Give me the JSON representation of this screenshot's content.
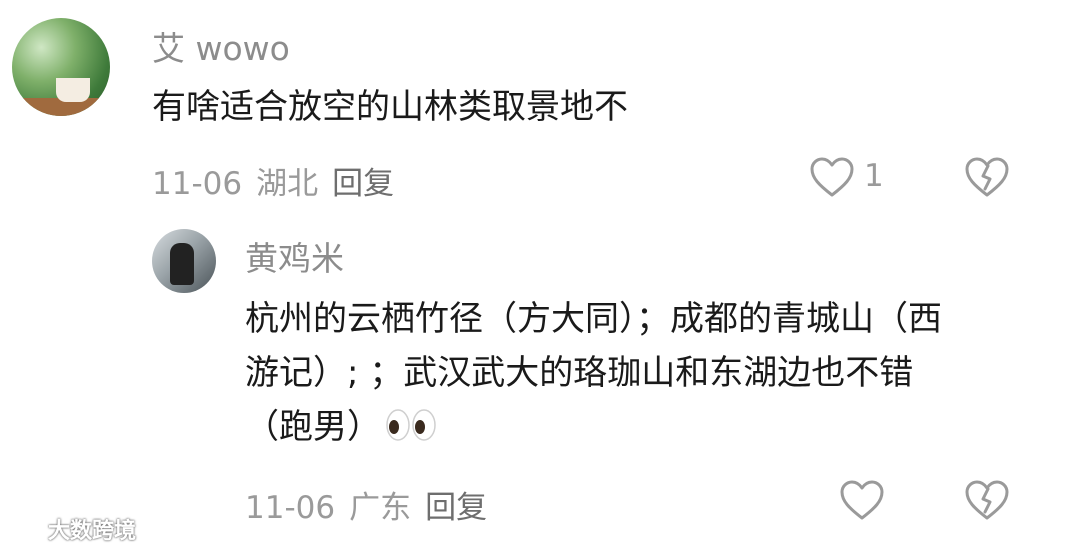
{
  "comment": {
    "author": "艾 wowo",
    "text": "有啥适合放空的山林类取景地不",
    "date": "11-06",
    "location": "湖北",
    "reply_label": "回复",
    "like_count": "1"
  },
  "reply": {
    "author": "黄鸡米",
    "lines": [
      "杭州的云栖竹径（方大同）；成都的青城山（西",
      "游记）; ；武汉武大的珞珈山和东湖边也不错",
      "（跑男）"
    ],
    "date": "11-06",
    "location": "广东",
    "reply_label": "回复"
  },
  "watermark": "大数跨境",
  "icons": [
    "heart-outline-icon",
    "broken-heart-icon",
    "eyes-emoji-icon",
    "watermark-logo-icon"
  ],
  "colors": {
    "meta_gray": "#9a9a9a",
    "name_gray": "#8c8c8c",
    "text": "#1a1a1a"
  }
}
